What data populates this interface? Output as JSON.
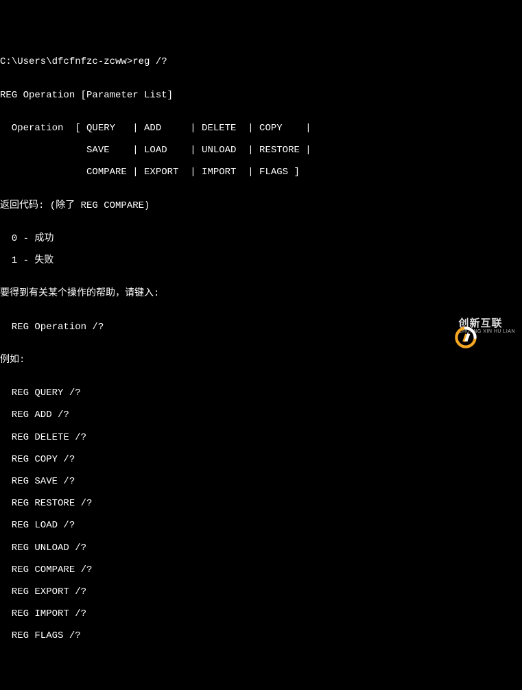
{
  "prompt": {
    "path": "C:\\Users\\dfcfnfzc-zcww>",
    "command": "reg /?"
  },
  "blank": "",
  "usage_header": "REG Operation [Parameter List]",
  "op_table": {
    "row1": "  Operation  [ QUERY   | ADD     | DELETE  | COPY    |",
    "row2": "               SAVE    | LOAD    | UNLOAD  | RESTORE |",
    "row3": "               COMPARE | EXPORT  | IMPORT  | FLAGS ]"
  },
  "return_codes_header": "返回代码: (除了 REG COMPARE)",
  "return_codes": {
    "r0": "  0 - 成功",
    "r1": "  1 - 失败"
  },
  "help_text": "要得到有关某个操作的帮助，请键入:",
  "help_syntax": "  REG Operation /?",
  "examples_header": "例如:",
  "examples": {
    "e0": "  REG QUERY /?",
    "e1": "  REG ADD /?",
    "e2": "  REG DELETE /?",
    "e3": "  REG COPY /?",
    "e4": "  REG SAVE /?",
    "e5": "  REG RESTORE /?",
    "e6": "  REG LOAD /?",
    "e7": "  REG UNLOAD /?",
    "e8": "  REG COMPARE /?",
    "e9": "  REG EXPORT /?",
    "e10": "  REG IMPORT /?",
    "e11": "  REG FLAGS /?"
  },
  "watermark": {
    "cn": "创新互联",
    "en": "CHUANG XIN HU LIAN"
  }
}
